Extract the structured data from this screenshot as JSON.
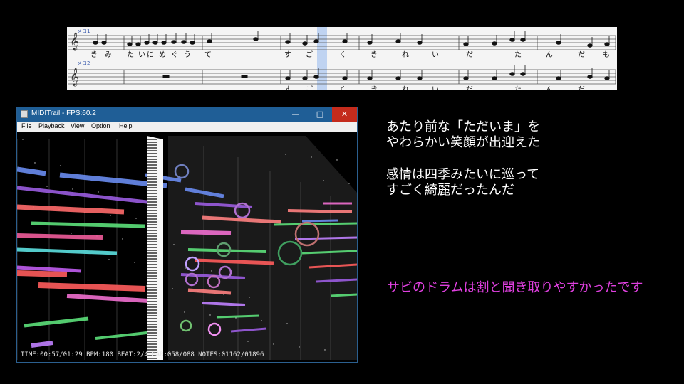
{
  "score": {
    "staff1_name": "メロ1",
    "staff2_name": "メロ2",
    "lyrics_line1": [
      "き",
      "み",
      "た",
      "い",
      "に",
      "め",
      "ぐ",
      "う",
      "て",
      "す",
      "ご",
      "く",
      "き",
      "れ",
      "い",
      "だ",
      "た",
      "ん",
      "だ",
      "も"
    ],
    "lyrics_line2": [
      "す",
      "ご",
      "く",
      "き",
      "れ",
      "い",
      "だ",
      "た",
      "ん",
      "だ"
    ]
  },
  "window": {
    "title": "MIDITrail - FPS:60.2",
    "min_glyph": "—",
    "max_glyph": "□",
    "close_glyph": "✕",
    "menu": [
      "File",
      "Playback",
      "View",
      "Option",
      "Help"
    ],
    "status": "TIME:00:57/01:29 BPM:180 BEAT:2/4 BAR:058/088 NOTES:01162/01896"
  },
  "lyrics": {
    "line1": "あたり前な「ただいま」を",
    "line2": "やわらかい笑顔が出迎えた",
    "line3": "感情は四季みたいに巡って",
    "line4": "すごく綺麗だったんだ"
  },
  "comment": "サビのドラムは割と聞き取りやすかったです",
  "colors": {
    "titlebar": "#1f5e96",
    "close": "#c42b1c",
    "comment": "#e040e0",
    "playhead": "#a8c4f0"
  }
}
